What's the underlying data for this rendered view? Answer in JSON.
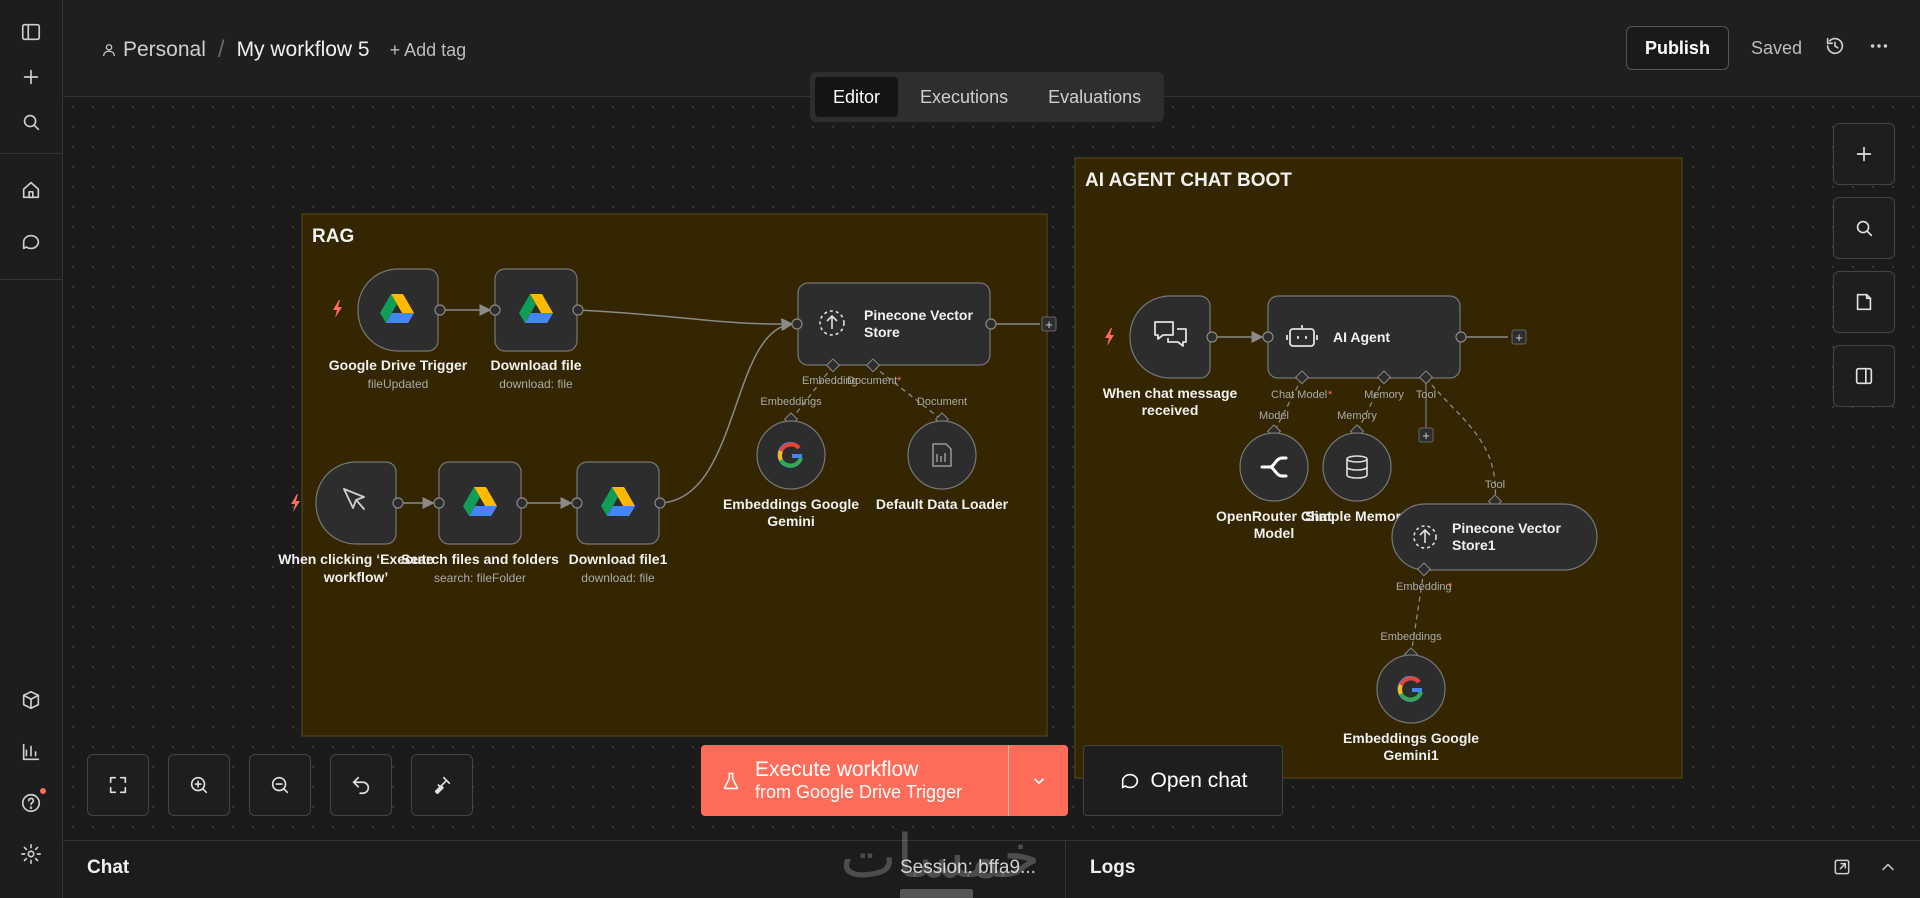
{
  "header": {
    "project": "Personal",
    "workflow_title": "My workflow 5",
    "add_tag": "+ Add tag",
    "publish": "Publish",
    "saved": "Saved"
  },
  "tabs": [
    {
      "label": "Editor",
      "active": true
    },
    {
      "label": "Executions",
      "active": false
    },
    {
      "label": "Evaluations",
      "active": false
    }
  ],
  "groups": {
    "rag": "RAG",
    "agent": "AI AGENT CHAT BOOT"
  },
  "nodes": {
    "gdrive_trigger": {
      "title": "Google Drive Trigger",
      "subtitle": "fileUpdated"
    },
    "download_file": {
      "title": "Download file",
      "subtitle": "download: file"
    },
    "manual_trigger": {
      "title_l1": "When clicking ‘Execute",
      "title_l2": "workflow’"
    },
    "search_files": {
      "title": "Search files and folders",
      "subtitle": "search: fileFolder"
    },
    "download_file1": {
      "title": "Download file1",
      "subtitle": "download: file"
    },
    "pinecone": {
      "title_l1": "Pinecone Vector",
      "title_l2": "Store"
    },
    "emb_gemini": {
      "title_l1": "Embeddings Google",
      "title_l2": "Gemini"
    },
    "data_loader": {
      "title": "Default Data Loader"
    },
    "chat_trigger": {
      "title_l1": "When chat message",
      "title_l2": "received"
    },
    "ai_agent": {
      "title": "AI Agent"
    },
    "openrouter": {
      "title_l1": "OpenRouter Chat",
      "title_l2": "Model"
    },
    "memory": {
      "title": "Simple Memory"
    },
    "pinecone1": {
      "title_l1": "Pinecone Vector",
      "title_l2": "Store1"
    },
    "emb_gemini1": {
      "title_l1": "Embeddings Google",
      "title_l2": "Gemini1"
    }
  },
  "ports": {
    "embedding": "Embedding",
    "document": "Document",
    "embeddings": "Embeddings",
    "chat_model": "Chat Model",
    "memory": "Memory",
    "tool": "Tool",
    "model": "Model",
    "required_mark": "*"
  },
  "execute": {
    "line1": "Execute workflow",
    "line2": "from Google Drive Trigger"
  },
  "open_chat": "Open chat",
  "bottom_panel": {
    "chat": "Chat",
    "session": "Session: bffa9...",
    "logs": "Logs"
  },
  "watermark": "خمسات",
  "colors": {
    "accent": "#ff6d5a",
    "sticky_bg": "#332600",
    "sticky_border": "#5c4a12",
    "node_bg": "#2d2d2d"
  }
}
